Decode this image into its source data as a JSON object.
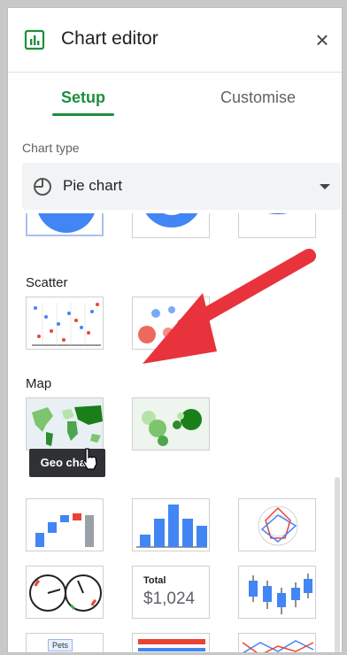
{
  "header": {
    "title": "Chart editor",
    "close_label": "×"
  },
  "tabs": [
    {
      "label": "Setup"
    },
    {
      "label": "Customise"
    }
  ],
  "chart_type": {
    "label": "Chart type",
    "selected": "Pie chart"
  },
  "sections": {
    "scatter": "Scatter",
    "map": "Map"
  },
  "tooltip": "Geo chart",
  "scorecard": {
    "label": "Total",
    "value": "$1,024"
  },
  "table_chip": "Pets",
  "colors": {
    "accent": "#1e8e3e",
    "blue": "#4285f4",
    "red": "#ea4335",
    "green": "#1a7f1a"
  }
}
